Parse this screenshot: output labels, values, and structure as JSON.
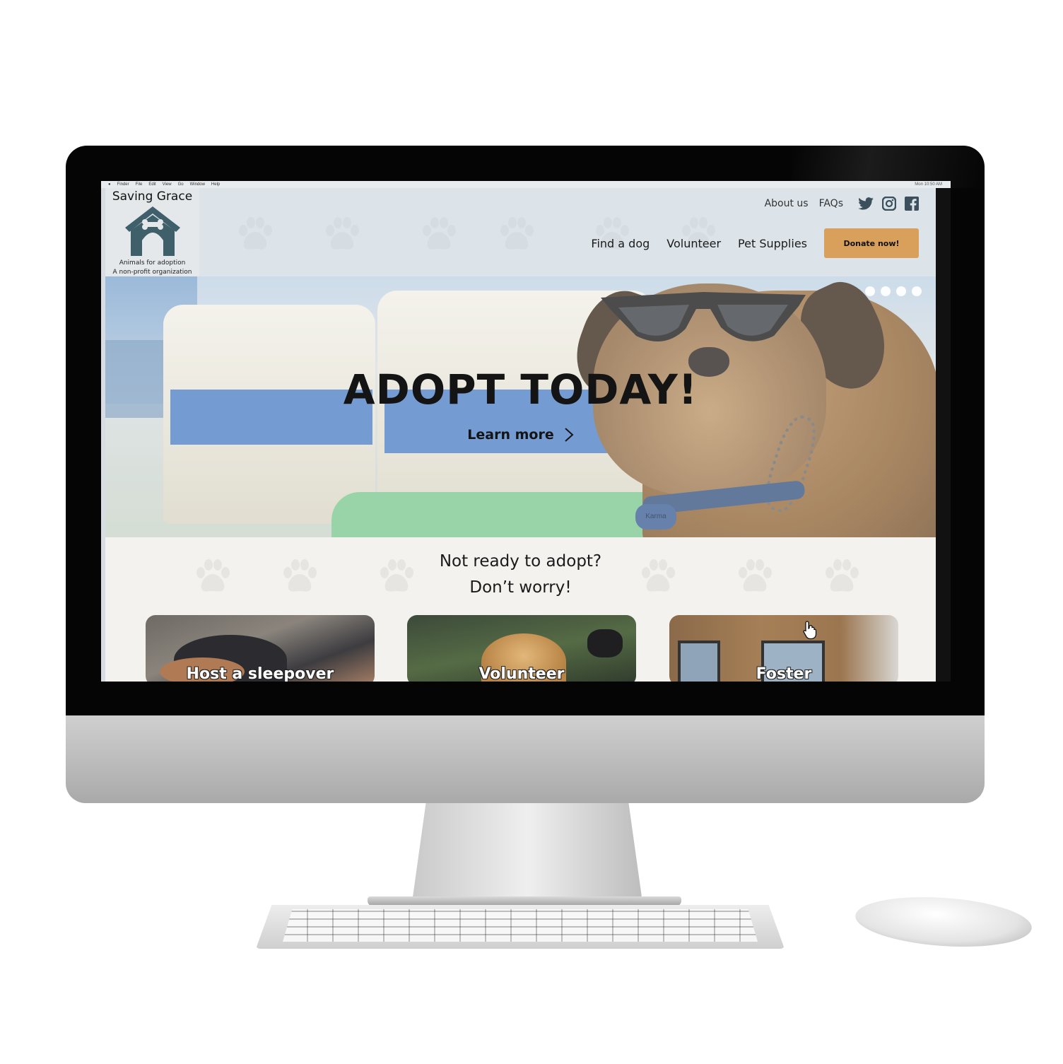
{
  "os_menubar": {
    "items": [
      "Finder",
      "File",
      "Edit",
      "View",
      "Go",
      "Window",
      "Help"
    ],
    "status": "Mon 10:50 AM"
  },
  "logo": {
    "title": "Saving Grace",
    "subtitle_line1": "Animals for adoption",
    "subtitle_line2": "A non-profit organization"
  },
  "top_links": {
    "about": "About us",
    "faqs": "FAQs",
    "social_icons": [
      "twitter-icon",
      "instagram-icon",
      "facebook-icon"
    ]
  },
  "main_nav": {
    "find_dog": "Find a dog",
    "volunteer": "Volunteer",
    "pet_supplies": "Pet Supplies",
    "donate_label": "Donate now!"
  },
  "hero": {
    "title": "ADOPT TODAY!",
    "cta_label": "Learn more",
    "tag_text": "Karma",
    "carousel_dot_count": 4
  },
  "cta_section": {
    "line1": "Not ready to adopt?",
    "line2": "Don’t worry!",
    "cards": [
      {
        "label": "Host a sleepover"
      },
      {
        "label": "Volunteer"
      },
      {
        "label": "Foster"
      }
    ]
  },
  "colors": {
    "header_bg": "#dce4ea",
    "accent_donate": "#d9a05b",
    "section_bg": "#f4f2ef",
    "logo_house": "#3f5f6a"
  }
}
